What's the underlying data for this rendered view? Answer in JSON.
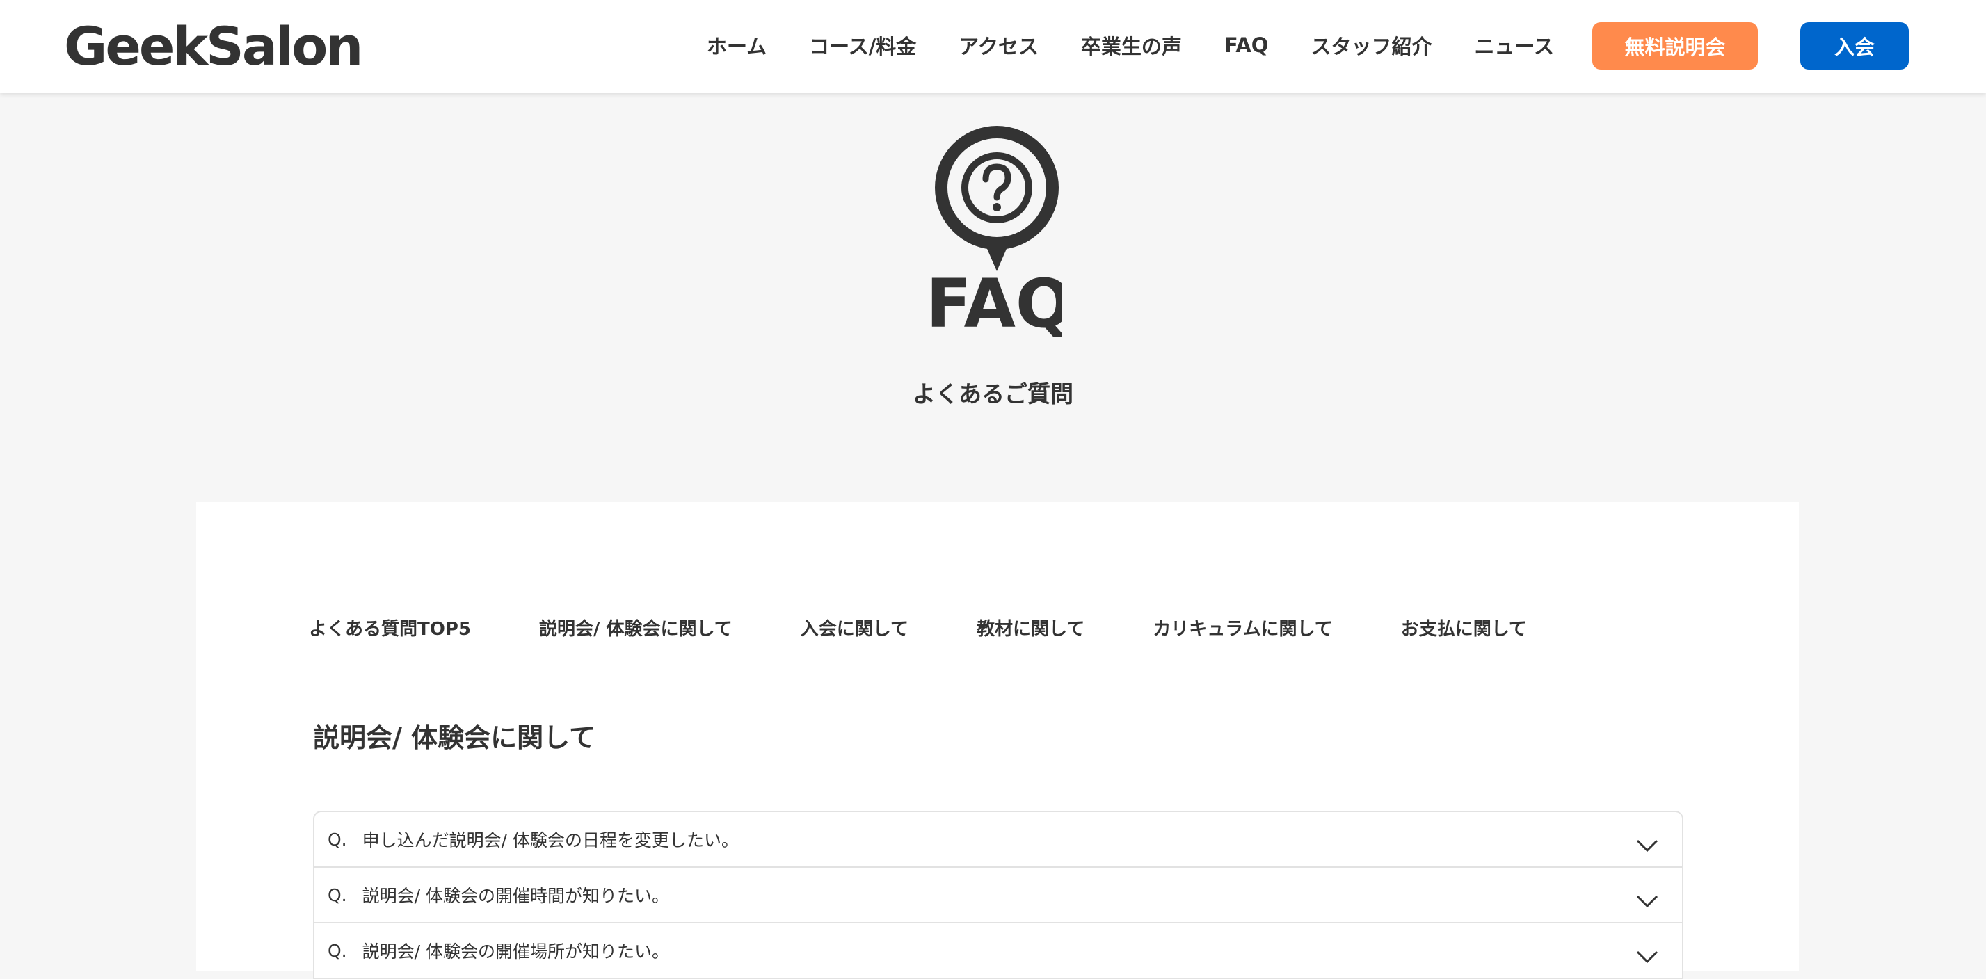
{
  "header": {
    "logo": "GeekSalon",
    "nav": [
      "ホーム",
      "コース/料金",
      "アクセス",
      "卒業生の声",
      "FAQ",
      "スタッフ紹介",
      "ニュース"
    ],
    "seminar_button": "無料説明会",
    "join_button": "入会",
    "seminar_color": "#ff8a4c",
    "join_color": "#0066cc"
  },
  "hero": {
    "icon": "question-pin-icon",
    "icon_label": "FAQ",
    "subtitle": "よくあるご質問"
  },
  "tabs": [
    "よくある質問TOP5",
    "説明会/ 体験会に関して",
    "入会に関して",
    "教材に関して",
    "カリキュラムに関して",
    "お支払に関して"
  ],
  "section": {
    "title": "説明会/ 体験会に関して"
  },
  "faq": {
    "prefix": "Q.",
    "items": [
      "申し込んだ説明会/ 体験会の日程を変更したい。",
      "説明会/ 体験会の開催時間が知りたい。",
      "説明会/ 体験会の開催場所が知りたい。"
    ]
  }
}
